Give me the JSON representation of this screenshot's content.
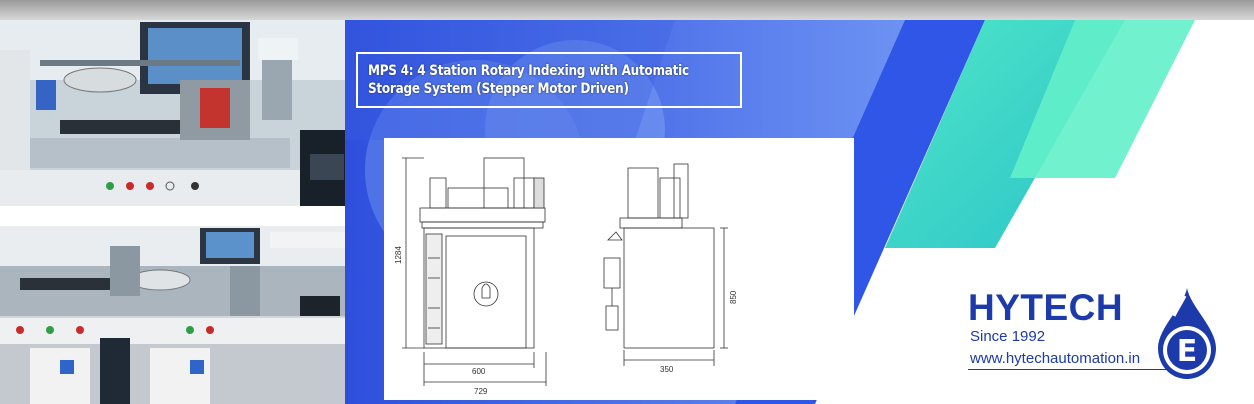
{
  "banner": {
    "title_line1": "MPS 4: 4 Station Rotary Indexing with Automatic",
    "title_line2": "Storage System (Stepper Motor Driven)"
  },
  "drawing": {
    "height_dim": "1284",
    "width_dim": "600",
    "overall_width_dim": "729",
    "side_height_dim": "850",
    "side_depth_dim": "350"
  },
  "company": {
    "name": "HYTECH",
    "since": "Since 1992",
    "website": "www.hytechautomation.in",
    "logo_letter": "E"
  },
  "colors": {
    "brand_blue": "#1c3aa9",
    "stripe_blue": "#2f56e6",
    "teal": "#3ee0c4",
    "panel_blue": "#4f78ef"
  }
}
